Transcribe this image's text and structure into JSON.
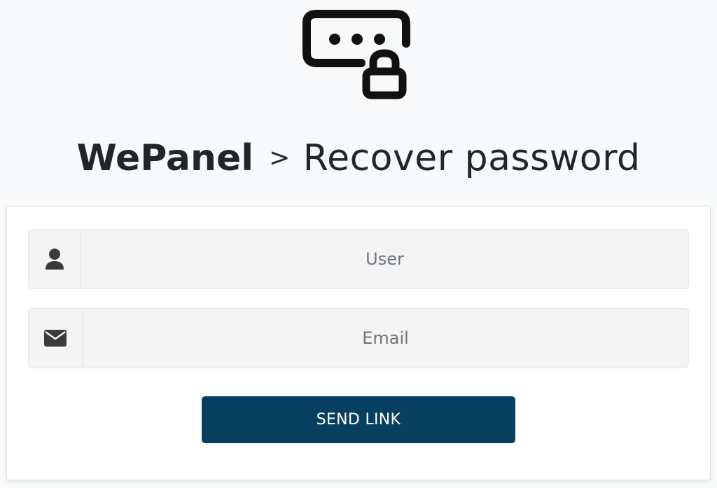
{
  "header": {
    "logo_icon": "password-lock-icon",
    "brand": "WePanel",
    "separator": ">",
    "subtitle": "Recover password"
  },
  "form": {
    "user": {
      "icon": "user-icon",
      "placeholder": "User",
      "value": ""
    },
    "email": {
      "icon": "envelope-icon",
      "placeholder": "Email",
      "value": ""
    },
    "submit_label": "SEND LINK"
  },
  "colors": {
    "page_background": "#f8f9fa",
    "card_background": "#ffffff",
    "input_background": "#f4f4f4",
    "button_background": "#073f61",
    "button_text": "#ffffff",
    "icon_color": "#212529"
  }
}
